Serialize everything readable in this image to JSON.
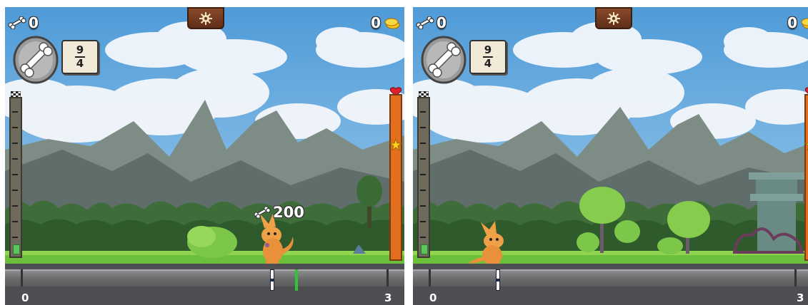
{
  "panels": [
    {
      "hud": {
        "bones": "0",
        "coins": "0",
        "fraction": {
          "numerator": "9",
          "denominator": "4"
        },
        "settings_icon": "gear-icon"
      },
      "number_line": {
        "start_label": "0",
        "end_label": "3"
      },
      "reward": {
        "amount": "200",
        "icon": "bone-icon"
      },
      "progress_meter_level": 0.06
    },
    {
      "hud": {
        "bones": "0",
        "coins": "0",
        "fraction": {
          "numerator": "9",
          "denominator": "4"
        },
        "settings_icon": "gear-icon"
      },
      "number_line": {
        "start_label": "0",
        "end_label": "3"
      },
      "progress_meter_level": 0.06
    }
  ],
  "colors": {
    "sky": "#6fb3e6",
    "health_bar": "#e36f1e",
    "target_marker": "#32c232",
    "number_line": "#4e4f52"
  }
}
